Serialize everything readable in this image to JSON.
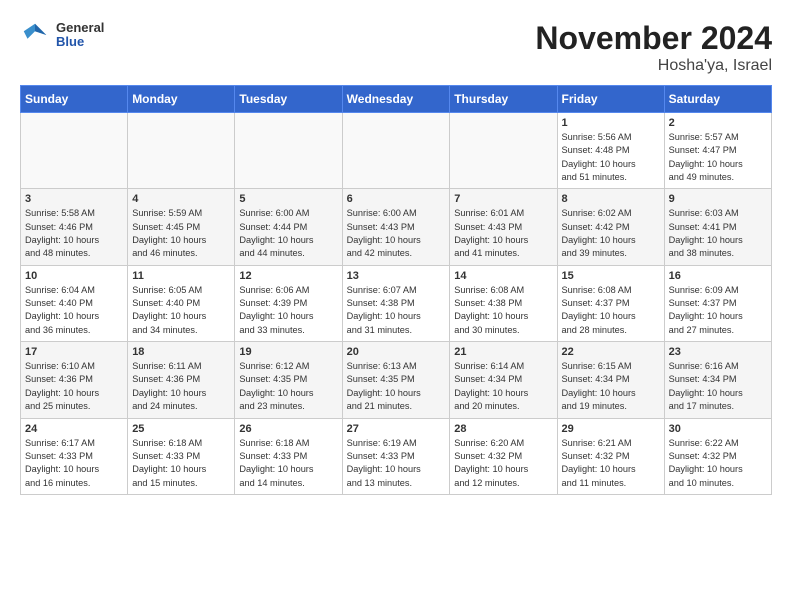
{
  "header": {
    "logo_general": "General",
    "logo_blue": "Blue",
    "title": "November 2024",
    "subtitle": "Hosha'ya, Israel"
  },
  "weekdays": [
    "Sunday",
    "Monday",
    "Tuesday",
    "Wednesday",
    "Thursday",
    "Friday",
    "Saturday"
  ],
  "weeks": [
    [
      {
        "day": "",
        "info": ""
      },
      {
        "day": "",
        "info": ""
      },
      {
        "day": "",
        "info": ""
      },
      {
        "day": "",
        "info": ""
      },
      {
        "day": "",
        "info": ""
      },
      {
        "day": "1",
        "info": "Sunrise: 5:56 AM\nSunset: 4:48 PM\nDaylight: 10 hours\nand 51 minutes."
      },
      {
        "day": "2",
        "info": "Sunrise: 5:57 AM\nSunset: 4:47 PM\nDaylight: 10 hours\nand 49 minutes."
      }
    ],
    [
      {
        "day": "3",
        "info": "Sunrise: 5:58 AM\nSunset: 4:46 PM\nDaylight: 10 hours\nand 48 minutes."
      },
      {
        "day": "4",
        "info": "Sunrise: 5:59 AM\nSunset: 4:45 PM\nDaylight: 10 hours\nand 46 minutes."
      },
      {
        "day": "5",
        "info": "Sunrise: 6:00 AM\nSunset: 4:44 PM\nDaylight: 10 hours\nand 44 minutes."
      },
      {
        "day": "6",
        "info": "Sunrise: 6:00 AM\nSunset: 4:43 PM\nDaylight: 10 hours\nand 42 minutes."
      },
      {
        "day": "7",
        "info": "Sunrise: 6:01 AM\nSunset: 4:43 PM\nDaylight: 10 hours\nand 41 minutes."
      },
      {
        "day": "8",
        "info": "Sunrise: 6:02 AM\nSunset: 4:42 PM\nDaylight: 10 hours\nand 39 minutes."
      },
      {
        "day": "9",
        "info": "Sunrise: 6:03 AM\nSunset: 4:41 PM\nDaylight: 10 hours\nand 38 minutes."
      }
    ],
    [
      {
        "day": "10",
        "info": "Sunrise: 6:04 AM\nSunset: 4:40 PM\nDaylight: 10 hours\nand 36 minutes."
      },
      {
        "day": "11",
        "info": "Sunrise: 6:05 AM\nSunset: 4:40 PM\nDaylight: 10 hours\nand 34 minutes."
      },
      {
        "day": "12",
        "info": "Sunrise: 6:06 AM\nSunset: 4:39 PM\nDaylight: 10 hours\nand 33 minutes."
      },
      {
        "day": "13",
        "info": "Sunrise: 6:07 AM\nSunset: 4:38 PM\nDaylight: 10 hours\nand 31 minutes."
      },
      {
        "day": "14",
        "info": "Sunrise: 6:08 AM\nSunset: 4:38 PM\nDaylight: 10 hours\nand 30 minutes."
      },
      {
        "day": "15",
        "info": "Sunrise: 6:08 AM\nSunset: 4:37 PM\nDaylight: 10 hours\nand 28 minutes."
      },
      {
        "day": "16",
        "info": "Sunrise: 6:09 AM\nSunset: 4:37 PM\nDaylight: 10 hours\nand 27 minutes."
      }
    ],
    [
      {
        "day": "17",
        "info": "Sunrise: 6:10 AM\nSunset: 4:36 PM\nDaylight: 10 hours\nand 25 minutes."
      },
      {
        "day": "18",
        "info": "Sunrise: 6:11 AM\nSunset: 4:36 PM\nDaylight: 10 hours\nand 24 minutes."
      },
      {
        "day": "19",
        "info": "Sunrise: 6:12 AM\nSunset: 4:35 PM\nDaylight: 10 hours\nand 23 minutes."
      },
      {
        "day": "20",
        "info": "Sunrise: 6:13 AM\nSunset: 4:35 PM\nDaylight: 10 hours\nand 21 minutes."
      },
      {
        "day": "21",
        "info": "Sunrise: 6:14 AM\nSunset: 4:34 PM\nDaylight: 10 hours\nand 20 minutes."
      },
      {
        "day": "22",
        "info": "Sunrise: 6:15 AM\nSunset: 4:34 PM\nDaylight: 10 hours\nand 19 minutes."
      },
      {
        "day": "23",
        "info": "Sunrise: 6:16 AM\nSunset: 4:34 PM\nDaylight: 10 hours\nand 17 minutes."
      }
    ],
    [
      {
        "day": "24",
        "info": "Sunrise: 6:17 AM\nSunset: 4:33 PM\nDaylight: 10 hours\nand 16 minutes."
      },
      {
        "day": "25",
        "info": "Sunrise: 6:18 AM\nSunset: 4:33 PM\nDaylight: 10 hours\nand 15 minutes."
      },
      {
        "day": "26",
        "info": "Sunrise: 6:18 AM\nSunset: 4:33 PM\nDaylight: 10 hours\nand 14 minutes."
      },
      {
        "day": "27",
        "info": "Sunrise: 6:19 AM\nSunset: 4:33 PM\nDaylight: 10 hours\nand 13 minutes."
      },
      {
        "day": "28",
        "info": "Sunrise: 6:20 AM\nSunset: 4:32 PM\nDaylight: 10 hours\nand 12 minutes."
      },
      {
        "day": "29",
        "info": "Sunrise: 6:21 AM\nSunset: 4:32 PM\nDaylight: 10 hours\nand 11 minutes."
      },
      {
        "day": "30",
        "info": "Sunrise: 6:22 AM\nSunset: 4:32 PM\nDaylight: 10 hours\nand 10 minutes."
      }
    ]
  ]
}
